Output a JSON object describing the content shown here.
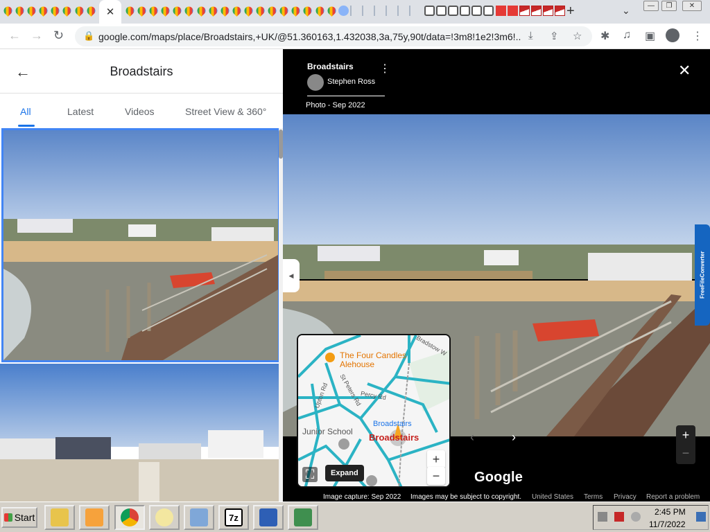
{
  "browser": {
    "active_tab_close": "✕",
    "new_tab": "+",
    "tab_menu": "⌄",
    "url": "google.com/maps/place/Broadstairs,+UK/@51.360163,1.432038,3a,75y,90t/data=!3m8!1e2!3m6!..."
  },
  "left_panel": {
    "title": "Broadstairs",
    "tabs": [
      "All",
      "Latest",
      "Videos",
      "Street View & 360°"
    ]
  },
  "viewer": {
    "place": "Broadstairs",
    "author": "Stephen Ross",
    "date": "Photo - Sep 2022",
    "google": "Google",
    "footer": {
      "capture": "Image capture: Sep 2022",
      "copyright": "Images may be subject to copyright.",
      "country": "United States",
      "terms": "Terms",
      "privacy": "Privacy",
      "report": "Report a problem"
    },
    "extension_label": "FreeFileConverter"
  },
  "minimap": {
    "poi1": "The Four Candles",
    "poi1b": "Alehouse",
    "town": "Broadstairs",
    "station": "Broadstairs",
    "school": "Junior School",
    "streets": [
      "Bradstow W",
      "St Peters Rd",
      "Percy Rd",
      "Upton Rd"
    ],
    "expand": "Expand"
  },
  "taskbar": {
    "start": "Start",
    "time": "2:45 PM",
    "date": "11/7/2022",
    "app_7z": "7z"
  }
}
